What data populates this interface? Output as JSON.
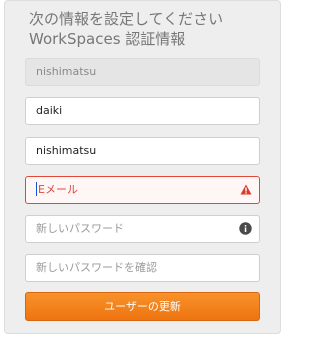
{
  "form": {
    "title_line1": "次の情報を設定してください",
    "title_line2": "WorkSpaces 認証情報",
    "workspace_id": "nishimatsu",
    "first_name": "daiki",
    "last_name": "nishimatsu",
    "email_placeholder": "E メール",
    "email_placeholder_rest": "メール",
    "email_placeholder_initial": "E",
    "new_password_placeholder": "新しいパスワード",
    "confirm_password_placeholder": "新しいパスワードを確認",
    "submit_label": "ユーザーの更新"
  },
  "colors": {
    "accent": "#f07e1b",
    "error": "#e0483a",
    "panel": "#eeeeee"
  },
  "icons": {
    "email_status": "warning-icon",
    "password_help": "info-icon"
  }
}
